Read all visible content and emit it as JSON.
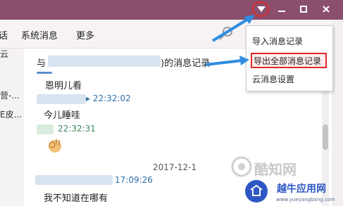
{
  "colors": {
    "titlebar": "#8a4f6d",
    "highlight": "#e0292b",
    "arrow": "#2f8de0",
    "time_blue": "#2e6fa8"
  },
  "tabs": [
    "话",
    "系统消息",
    "更多"
  ],
  "sidebar": {
    "items": [
      "云",
      "营-...",
      "E皮..."
    ]
  },
  "messages": [
    {
      "text": "恩明儿看",
      "time": "22:32:02"
    },
    {
      "text": "今儿睡哇",
      "time": "22:32:31"
    },
    {
      "text": "我不知道在哪有",
      "time": "17:09:26"
    }
  ],
  "history_header": {
    "prefix": "与",
    "suffix": ")的消息记录"
  },
  "date_label": "2017-12-1",
  "menu": {
    "items": [
      "导入消息记录",
      "导出全部消息记录",
      "云消息设置"
    ]
  },
  "icons": [
    "dropdown-triangle-icon",
    "minimize-icon",
    "maximize-icon",
    "close-icon",
    "search-icon",
    "ok-hand-emoji-icon"
  ],
  "watermark": {
    "logo": "酷知网",
    "site": "越牛应用网",
    "url": "www.yueyangbang.com"
  }
}
